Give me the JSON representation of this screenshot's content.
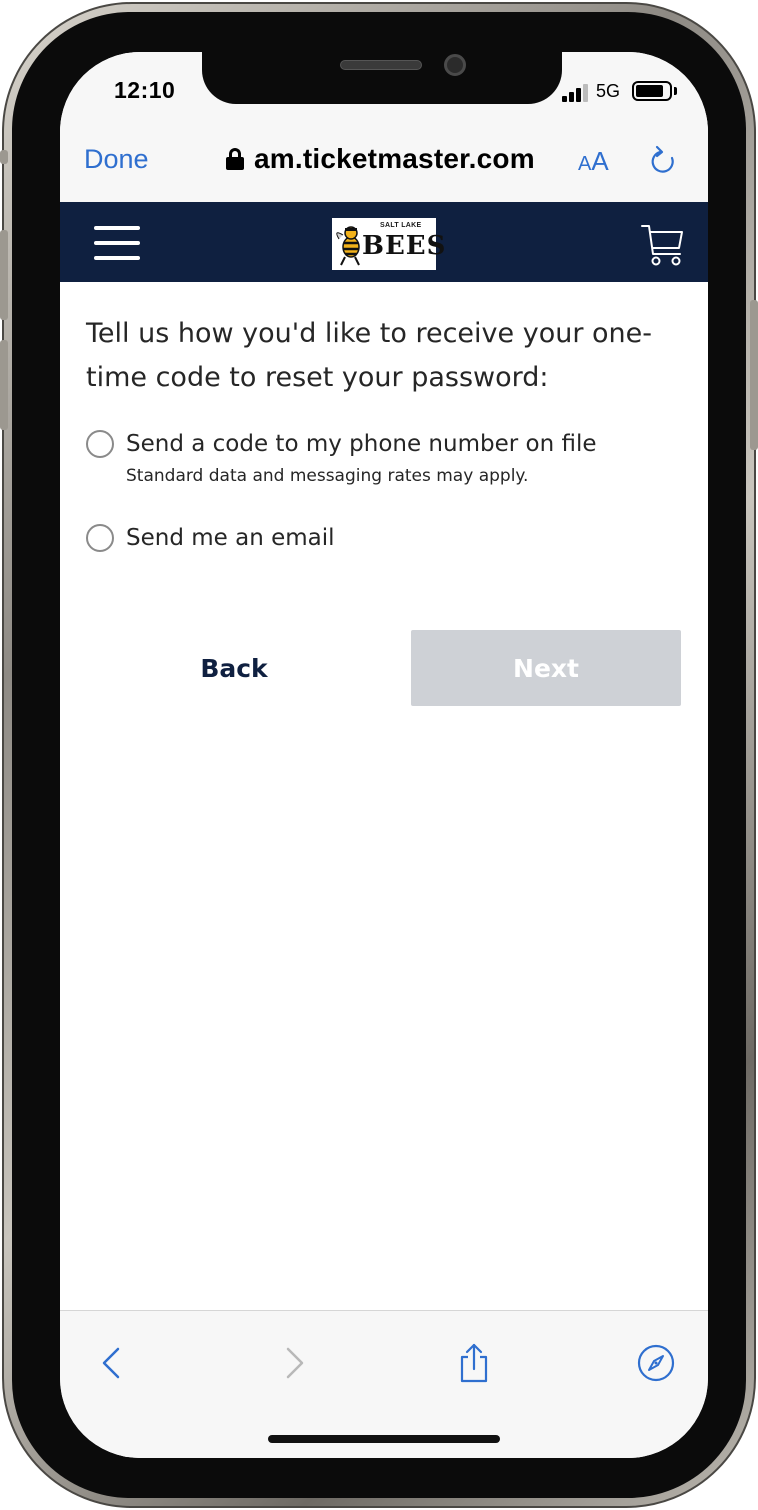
{
  "status_bar": {
    "time": "12:10",
    "network": "5G",
    "battery_level": 0.85
  },
  "browser": {
    "done_label": "Done",
    "url": "am.ticketmaster.com",
    "text_size_small": "A",
    "text_size_large": "A",
    "icons": [
      "lock-icon",
      "reload-icon"
    ]
  },
  "site_nav": {
    "logo": {
      "small_text": "SALT LAKE",
      "main_text": "BEES"
    },
    "icons": [
      "menu-icon",
      "cart-icon"
    ],
    "background_color": "#0f2040"
  },
  "form": {
    "prompt": "Tell us how you'd like to receive your one-time code to reset your password:",
    "options": [
      {
        "label": "Send a code to my phone number on file",
        "note": "Standard data and messaging rates may apply.",
        "selected": false
      },
      {
        "label": "Send me an email",
        "selected": false
      }
    ],
    "back_label": "Back",
    "next_label": "Next",
    "next_enabled": false,
    "next_disabled_color": "#ced1d6"
  },
  "toolbar": {
    "icons": [
      "back-arrow-icon",
      "forward-arrow-icon",
      "share-icon",
      "compass-icon"
    ],
    "accent_color": "#2f6fcf"
  }
}
